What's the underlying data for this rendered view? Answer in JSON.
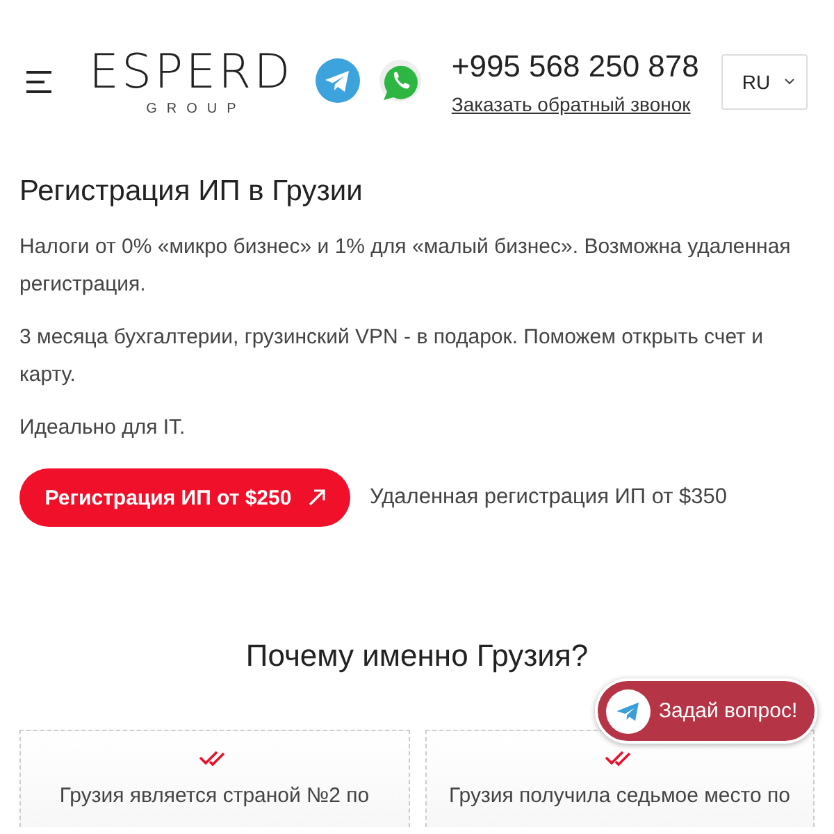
{
  "header": {
    "logo": "ESPERD",
    "logo_sub": "GROUP",
    "phone": "+995 568 250 878",
    "callback_link": "Заказать обратный звонок",
    "language": "RU"
  },
  "hero": {
    "title": "Регистрация ИП в Грузии",
    "paragraphs": [
      "Налоги от 0% «микро бизнес» и 1% для «малый бизнес». Возможна удаленная регистрация.",
      "3 месяца бухгалтерии, грузинский VPN - в подарок. Поможем открыть счет и карту.",
      "Идеально для IT."
    ],
    "primary_button": "Регистрация ИП от $250",
    "secondary_link": "Удаленная регистрация ИП от $350"
  },
  "why": {
    "title": "Почему именно Грузия?",
    "cards": [
      {
        "text": "Грузия является страной №2 по"
      },
      {
        "text": "Грузия получила седьмое место по"
      }
    ]
  },
  "chat_button": {
    "label": "Задай вопрос!"
  }
}
